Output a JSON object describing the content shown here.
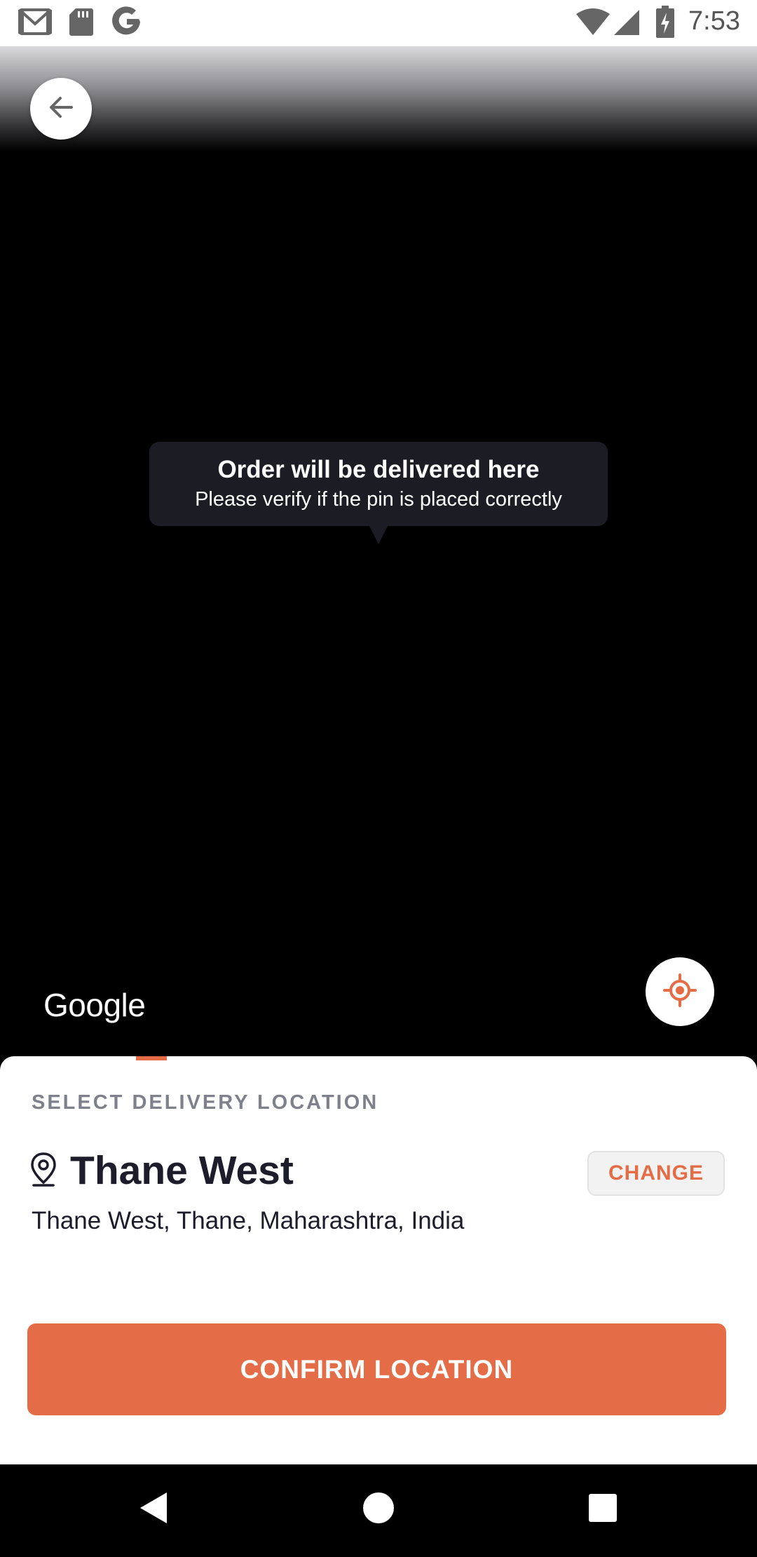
{
  "status_bar": {
    "time": "7:53",
    "icons": [
      "gmail-icon",
      "sd-card-icon",
      "google-icon",
      "wifi-icon",
      "signal-icon",
      "battery-charging-icon"
    ]
  },
  "map": {
    "tooltip": {
      "title": "Order will be delivered here",
      "subtitle": "Please verify if the pin is placed correctly"
    },
    "google_logo": "Google",
    "back_icon": "arrow-back-icon",
    "locate_icon": "my-location-icon"
  },
  "sheet": {
    "section_label": "SELECT DELIVERY LOCATION",
    "location_title": "Thane West",
    "location_address": "Thane West, Thane, Maharashtra, India",
    "change_label": "CHANGE",
    "confirm_label": "CONFIRM LOCATION"
  },
  "nav_bar": {
    "icons": [
      "back-triangle-icon",
      "home-circle-icon",
      "recents-square-icon"
    ]
  },
  "colors": {
    "accent": "#e46d47",
    "text_dark": "#1c1c2a",
    "text_muted": "#7e808c",
    "tooltip_bg": "#1c1c24"
  }
}
